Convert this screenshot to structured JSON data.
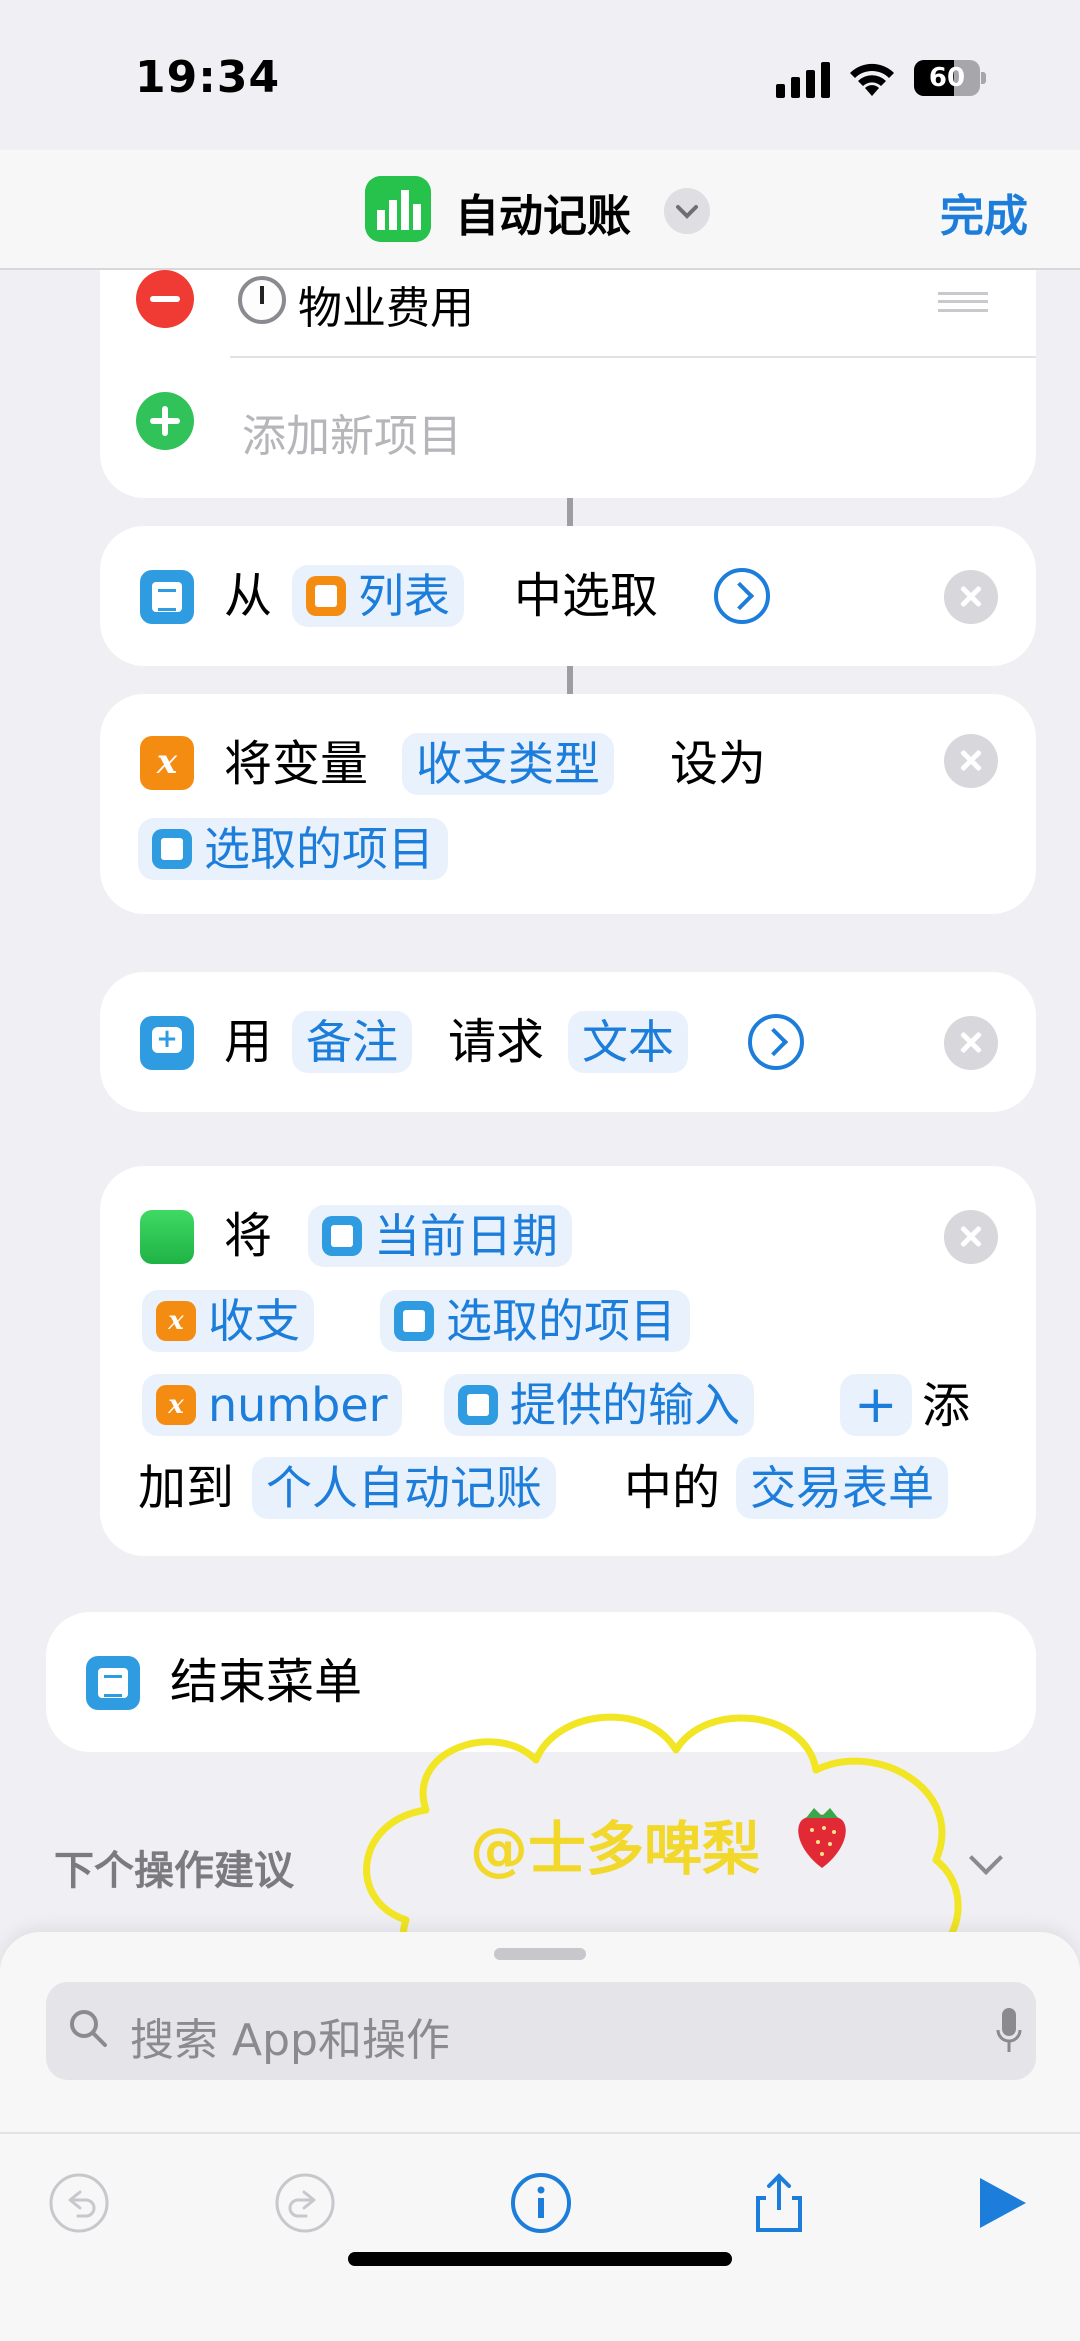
{
  "status_bar": {
    "time": "19:34",
    "battery": "60",
    "battery_level": 0.6
  },
  "nav": {
    "title": "自动记账",
    "done": "完成"
  },
  "list_card": {
    "item": "物业费用",
    "add_new": "添加新项目"
  },
  "action_choose": {
    "from": "从",
    "list_chip": "列表",
    "suffix": "中选取"
  },
  "action_setvar": {
    "prefix": "将变量",
    "var_chip": "收支类型",
    "set_to": "设为",
    "value_chip": "选取的项目"
  },
  "action_ask": {
    "use": "用",
    "note_chip": "备注",
    "ask": "请求",
    "type_chip": "文本"
  },
  "action_add": {
    "verb": "将",
    "date_chip": "当前日期",
    "var1_chip": "收支",
    "item_chip": "选取的项目",
    "number_chip": "number",
    "input_chip": "提供的输入",
    "plus": "+",
    "add_char": "添",
    "add_to": "加到",
    "doc_chip": "个人自动记账",
    "in": "中的",
    "sheet_chip": "交易表单"
  },
  "end_menu": {
    "label": "结束菜单"
  },
  "suggestions": {
    "label": "下个操作建议"
  },
  "watermark": {
    "text": "@士多啤梨"
  },
  "search": {
    "placeholder": "搜索 App和操作"
  },
  "icons": {
    "undo": "undo-icon",
    "redo": "redo-icon",
    "info": "info-icon",
    "share": "share-icon",
    "play": "play-icon"
  },
  "colors": {
    "accent": "#1c7ddb",
    "background": "#efeff4",
    "delete": "#ef3b33",
    "add": "#31c25a",
    "variable": "#f58c12",
    "watermark": "#f1d82a"
  }
}
